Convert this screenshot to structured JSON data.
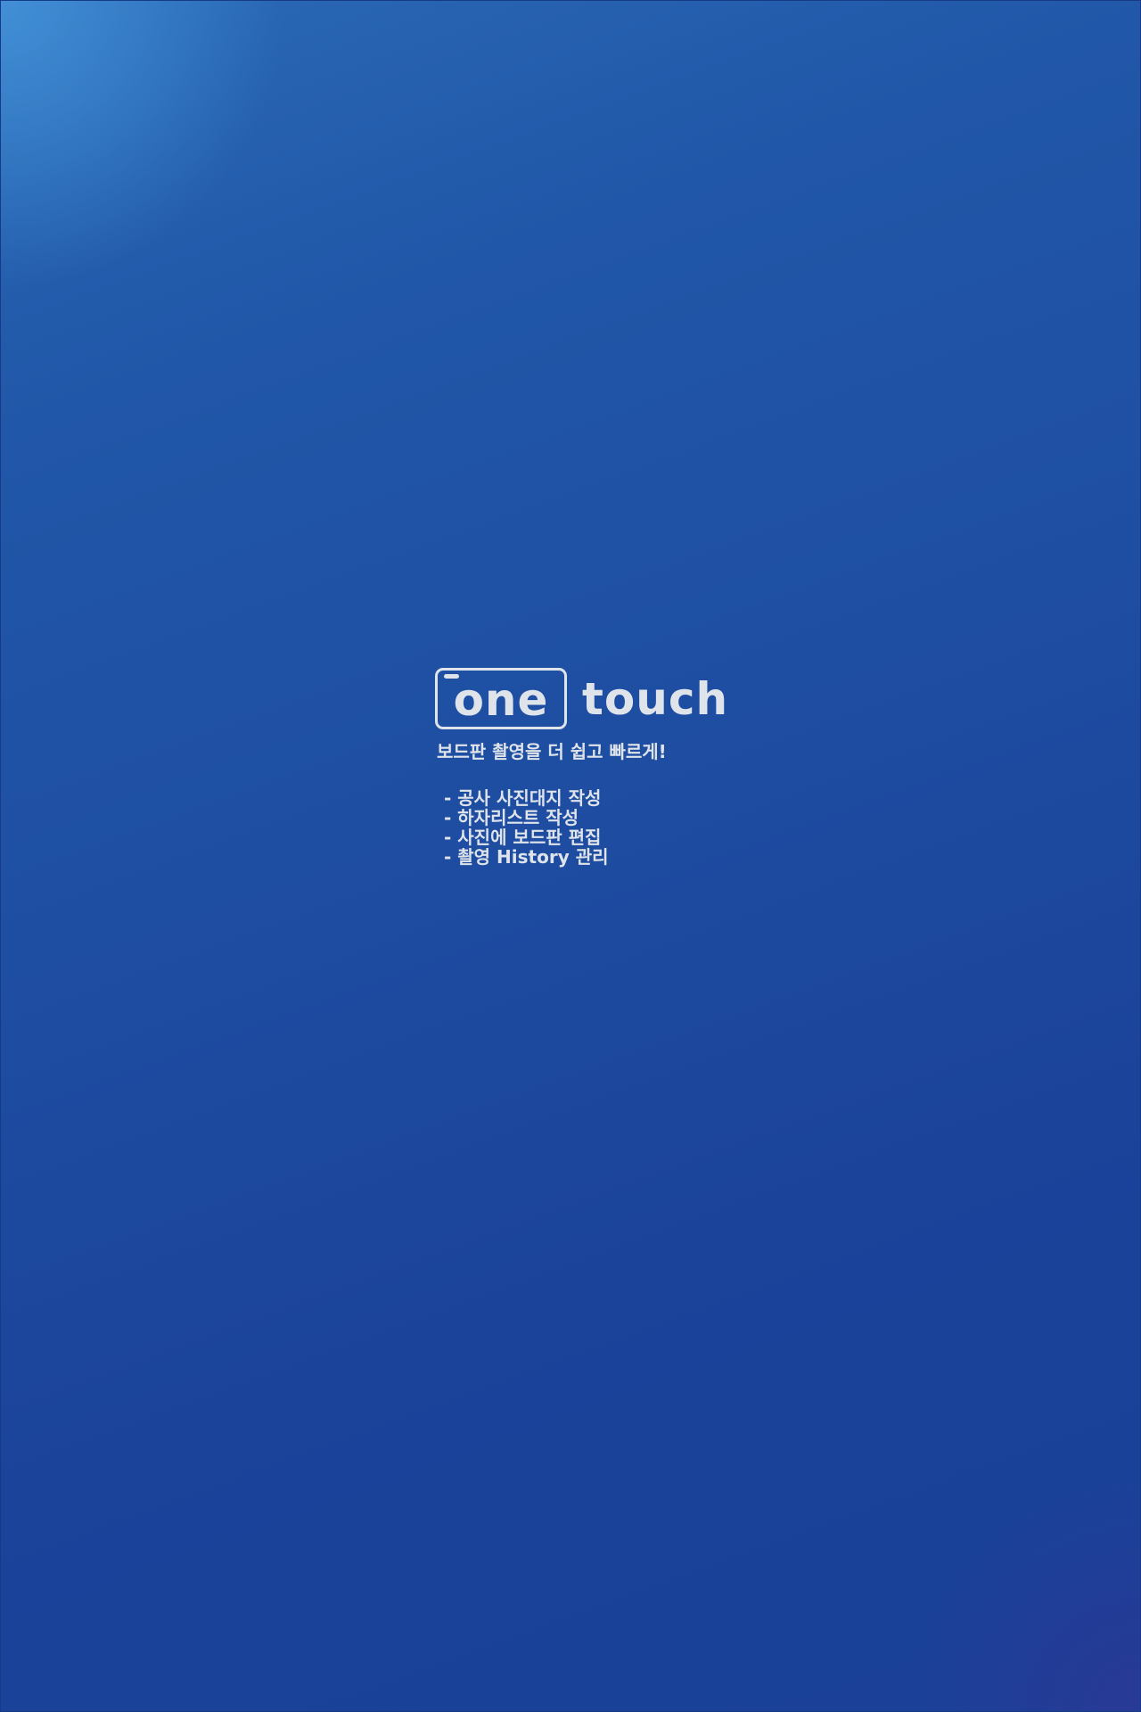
{
  "colors": {
    "background_top": "#2a6ab6",
    "background_bottom": "#1a4097",
    "text": "#dfe3ea"
  },
  "logo": {
    "boxed_word": "one",
    "word": "touch",
    "icon": "camera-frame-icon"
  },
  "tagline": "보드판 촬영을 더 쉽고 빠르게!",
  "features": [
    "- 공사 사진대지 작성",
    "- 하자리스트 작성",
    "- 사진에 보드판 편집",
    "- 촬영 History 관리"
  ]
}
